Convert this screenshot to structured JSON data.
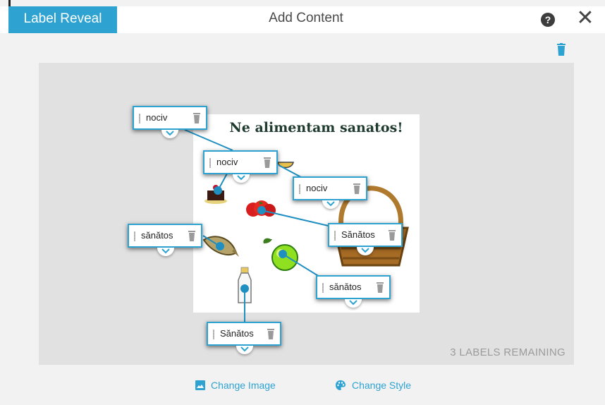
{
  "header": {
    "tab_active": "Label Reveal",
    "title": "Add Content",
    "help_icon": "?",
    "close_icon": "✕"
  },
  "image": {
    "title": "Ne alimentam sanatos!"
  },
  "labels": [
    {
      "text": "nociv"
    },
    {
      "text": "nociv"
    },
    {
      "text": "nociv"
    },
    {
      "text": "sănătos"
    },
    {
      "text": "Sănătos"
    },
    {
      "text": "sănătos"
    },
    {
      "text": "Sănătos"
    }
  ],
  "status": {
    "remaining": "3 LABELS REMAINING"
  },
  "footer": {
    "change_image": "Change Image",
    "change_style": "Change Style"
  },
  "colors": {
    "accent": "#2ea3d2",
    "canvas": "#e1e1e1"
  }
}
